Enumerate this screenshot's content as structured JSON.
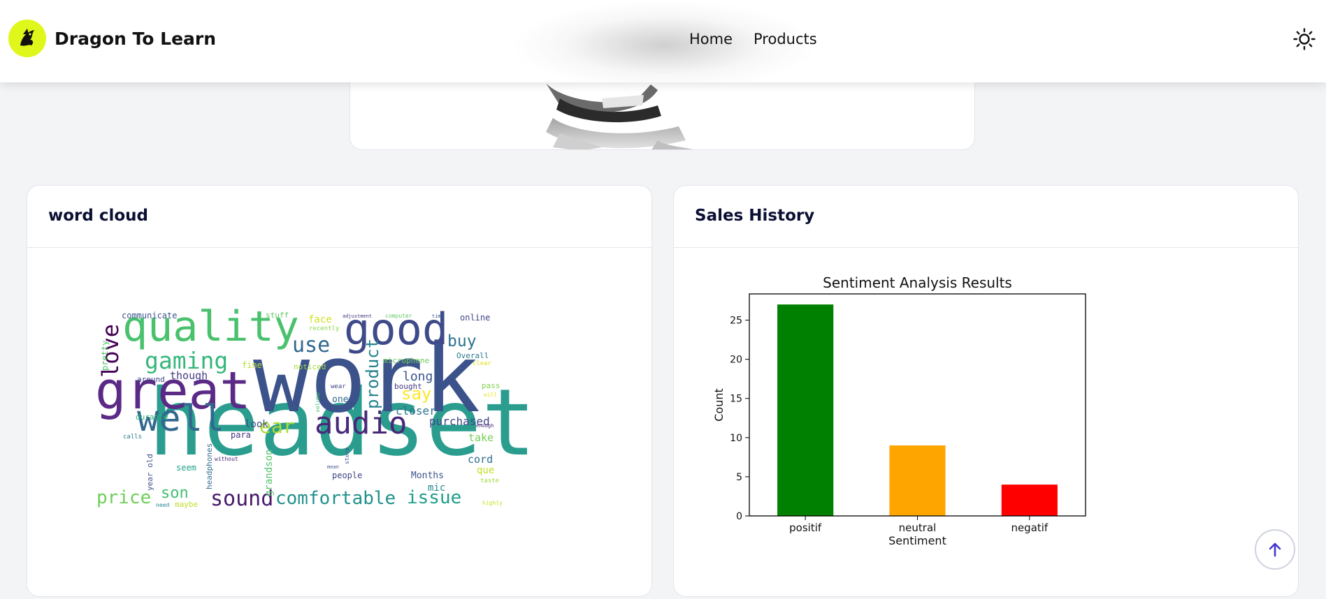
{
  "header": {
    "brand": "Dragon To Learn",
    "nav": [
      {
        "label": "Home"
      },
      {
        "label": "Products"
      }
    ],
    "theme_icon": "sun-icon"
  },
  "cards": {
    "word_cloud": {
      "title": "word cloud"
    },
    "sales_history": {
      "title": "Sales History"
    }
  },
  "word_cloud": {
    "words": [
      "work",
      "headset",
      "great",
      "quality",
      "good",
      "well",
      "audio",
      "gaming",
      "love",
      "sound",
      "comfortable",
      "issue",
      "price",
      "use",
      "ear",
      "product",
      "say",
      "buy",
      "son",
      "long",
      "closer",
      "purchased",
      "take",
      "cord",
      "que",
      "Months",
      "mic",
      "people",
      "one",
      "look",
      "para",
      "fine",
      "noticed",
      "though",
      "around",
      "durable",
      "communicate",
      "stuff",
      "face",
      "online",
      "adjustment",
      "computer",
      "Overall",
      "microphone",
      "clear",
      "bought",
      "headphones",
      "grandson",
      "seem",
      "year old",
      "maybe",
      "need",
      "highly",
      "taste",
      "pass",
      "will",
      "calls",
      "without",
      "pretty",
      "store",
      "volume",
      "wear",
      "recently",
      "time",
      "mean",
      "enough",
      "noticed"
    ]
  },
  "chart_data": {
    "type": "bar",
    "title": "Sentiment Analysis Results",
    "xlabel": "Sentiment",
    "ylabel": "Count",
    "categories": [
      "positif",
      "neutral",
      "negatif"
    ],
    "values": [
      27,
      9,
      4
    ],
    "colors": [
      "#008000",
      "#ffa500",
      "#ff0000"
    ],
    "ylim": [
      0,
      28.35
    ],
    "yticks": [
      0,
      5,
      10,
      15,
      20,
      25
    ]
  },
  "scroll_top_icon": "arrow-up-icon"
}
